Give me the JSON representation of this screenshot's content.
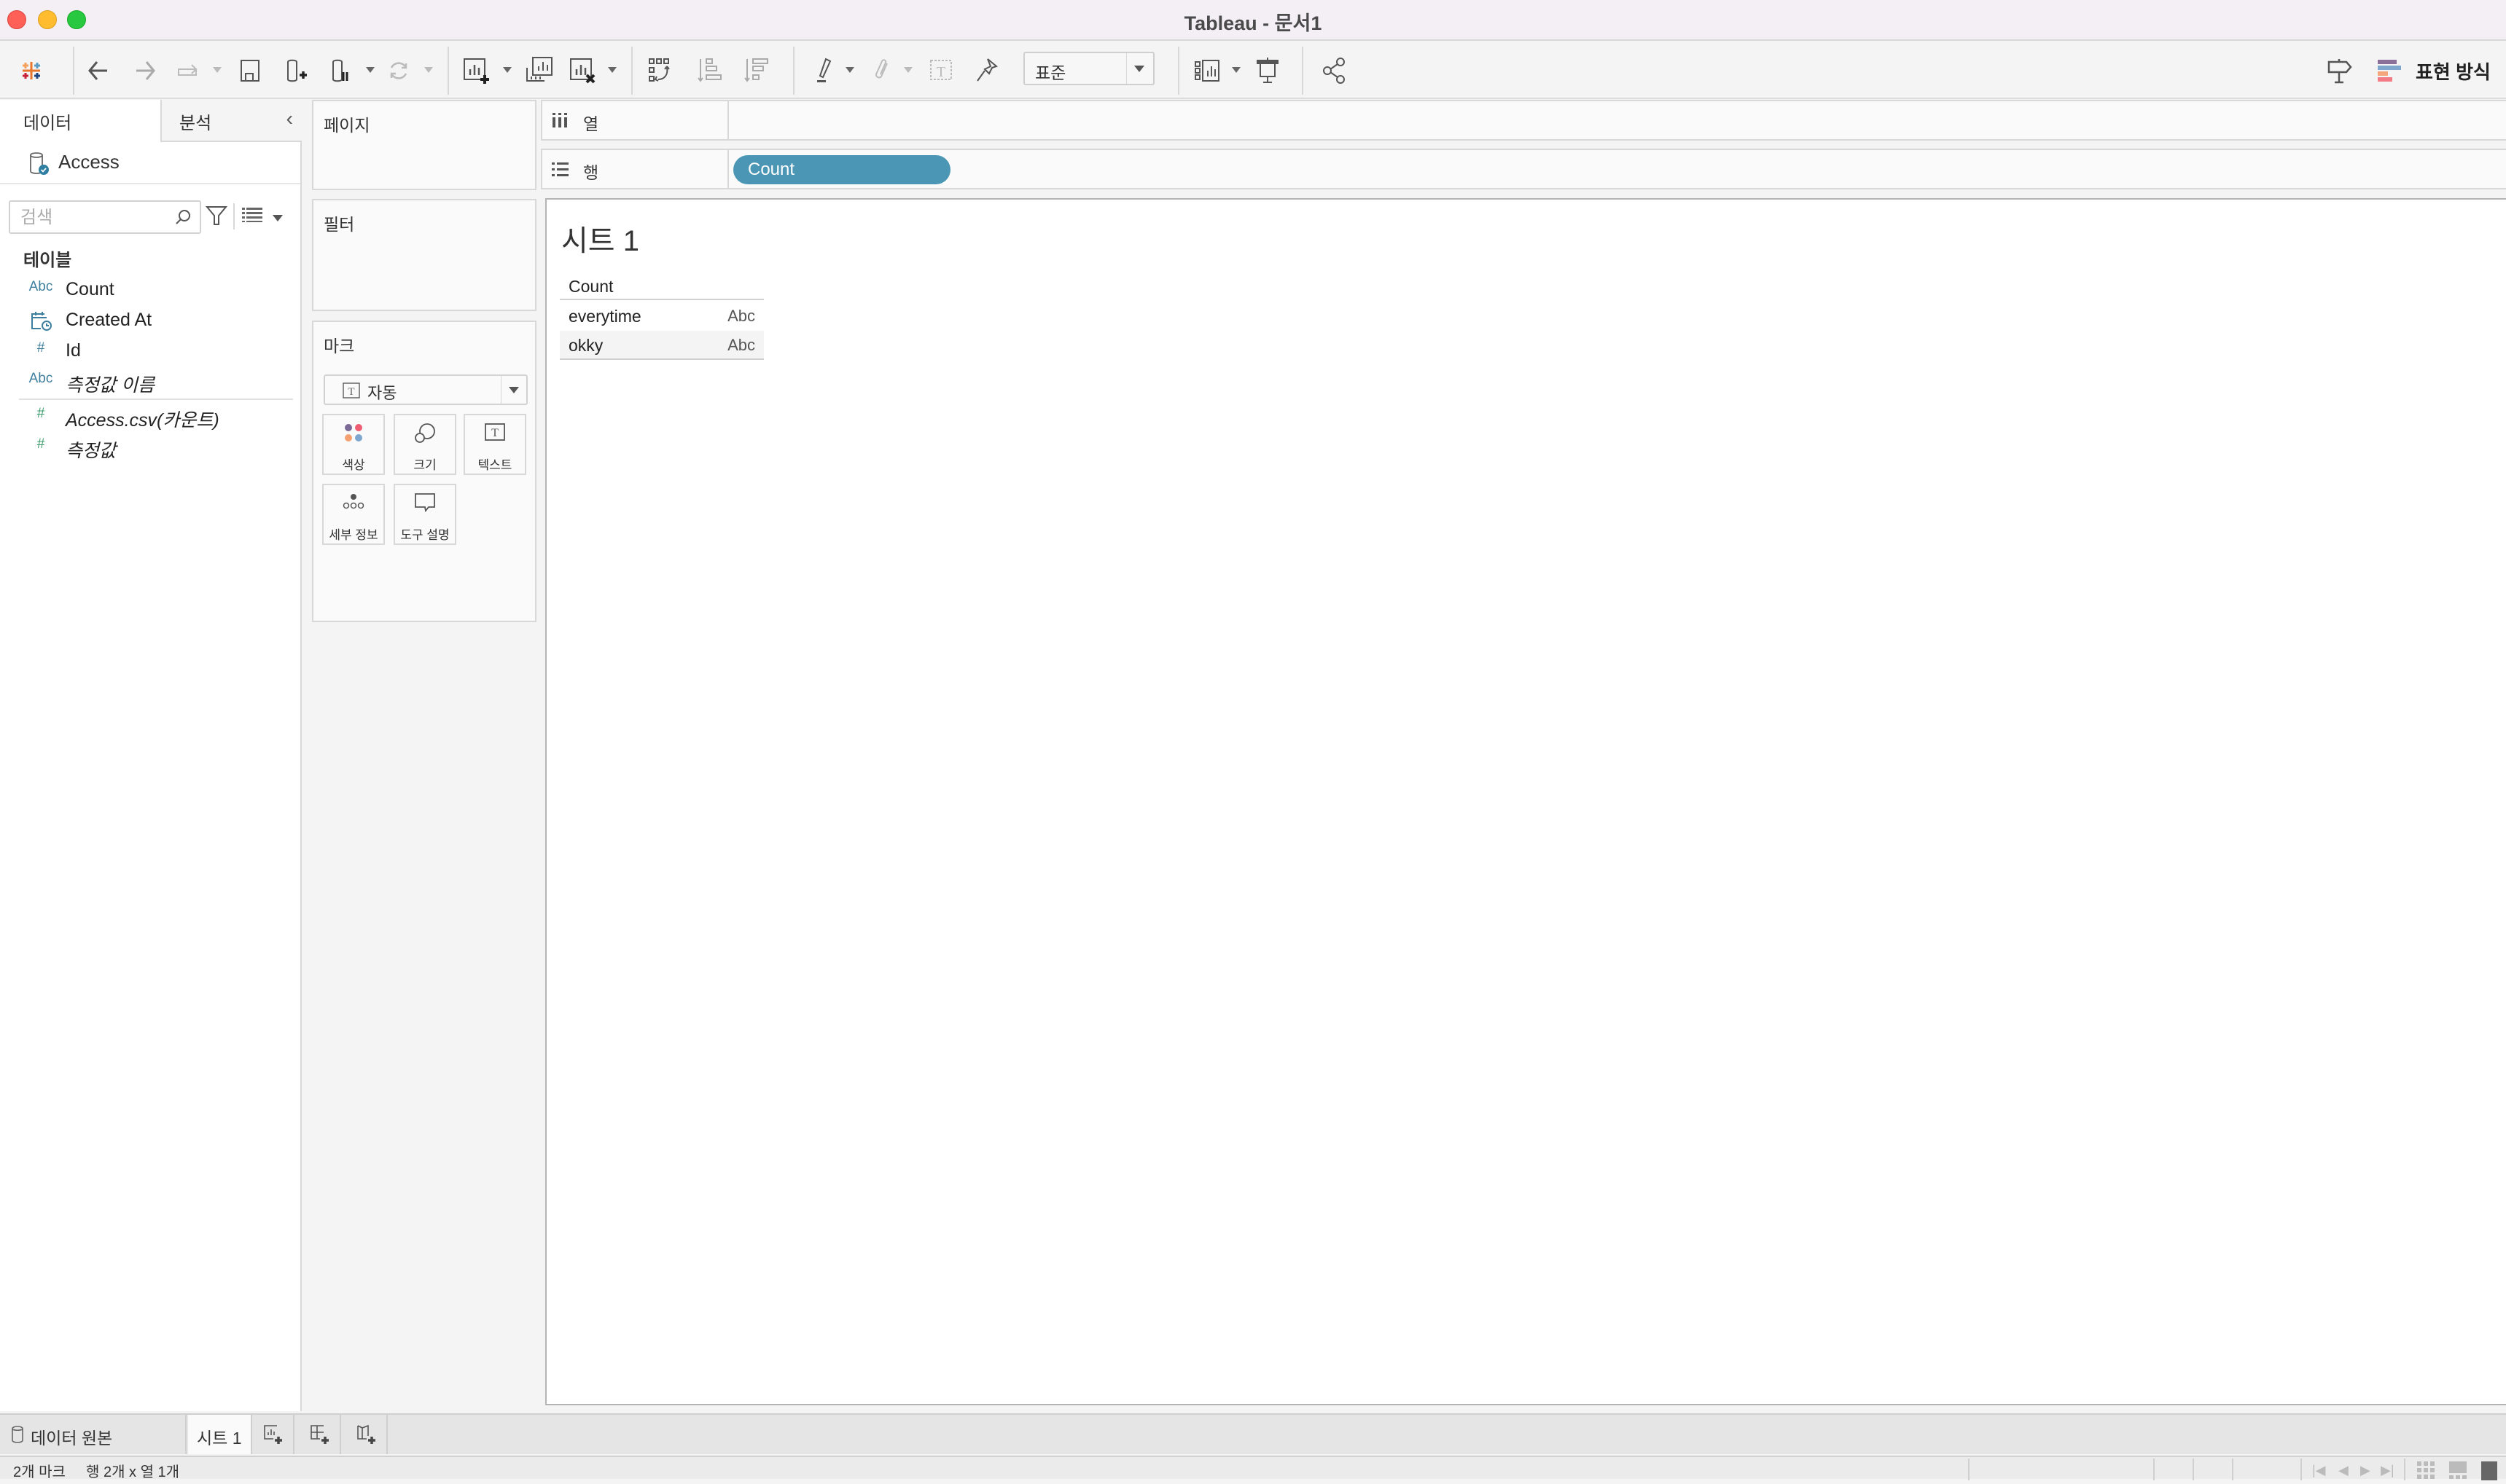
{
  "window": {
    "title": "Tableau - 문서1"
  },
  "toolbar": {
    "fit_select": {
      "value": "표준"
    },
    "show_me_label": "표현 방식",
    "icons": [
      "tableau-logo-icon",
      "undo-icon",
      "redo-icon",
      "replay-icon",
      "save-icon",
      "new-data-source-icon",
      "pause-updates-icon",
      "refresh-icon",
      "new-worksheet-icon",
      "duplicate-sheet-icon",
      "clear-sheet-icon",
      "swap-rows-columns-icon",
      "sort-ascending-icon",
      "sort-descending-icon",
      "highlight-icon",
      "group-members-icon",
      "show-labels-icon",
      "pin-axes-icon",
      "show-cards-icon",
      "presentation-mode-icon",
      "share-icon",
      "guide-icon"
    ]
  },
  "sidebar": {
    "tabs": [
      {
        "label": "데이터",
        "active": true
      },
      {
        "label": "분석",
        "active": false
      }
    ],
    "data_source": "Access",
    "search": {
      "placeholder": "검색",
      "value": ""
    },
    "tables_heading": "테이블",
    "fields": [
      {
        "type": "Abc",
        "type_icon": "string-icon",
        "name": "Count",
        "italic": false
      },
      {
        "type": "date",
        "type_icon": "datetime-icon",
        "name": "Created At",
        "italic": false
      },
      {
        "type": "#",
        "type_icon": "number-icon",
        "name": "Id",
        "italic": false
      },
      {
        "type": "Abc",
        "type_icon": "string-icon",
        "name": "측정값 이름",
        "italic": true
      }
    ],
    "measures": [
      {
        "type": "#",
        "type_icon": "measure-number-icon",
        "name": "Access.csv(카운트)",
        "italic": true
      },
      {
        "type": "#",
        "type_icon": "measure-number-icon",
        "name": "측정값",
        "italic": true
      }
    ]
  },
  "shelves": {
    "pages": "페이지",
    "filters": "필터",
    "marks": {
      "title": "마크",
      "mark_type": "자동",
      "buttons": [
        {
          "label": "색상",
          "icon": "color-icon"
        },
        {
          "label": "크기",
          "icon": "size-icon"
        },
        {
          "label": "텍스트",
          "icon": "text-icon"
        },
        {
          "label": "세부 정보",
          "icon": "detail-icon"
        },
        {
          "label": "도구 설명",
          "icon": "tooltip-icon"
        }
      ]
    },
    "columns": {
      "label": "열",
      "pills": []
    },
    "rows": {
      "label": "행",
      "pills": [
        {
          "label": "Count",
          "color": "#4a96b4"
        }
      ]
    }
  },
  "canvas": {
    "sheet_title": "시트 1",
    "table": {
      "header": "Count",
      "rows": [
        {
          "dimension": "everytime",
          "mark": "Abc"
        },
        {
          "dimension": "okky",
          "mark": "Abc"
        }
      ]
    }
  },
  "tabbar": {
    "data_source_tab": "데이터 원본",
    "sheets": [
      {
        "label": "시트 1",
        "active": true
      }
    ],
    "new_sheet_icons": [
      "new-worksheet-icon",
      "new-dashboard-icon",
      "new-story-icon"
    ]
  },
  "statusbar": {
    "marks": "2개 마크",
    "dimensions": "행 2개 x 열 1개"
  },
  "colors": {
    "accent_pill": "#4a96b4",
    "dimension_icon": "#3e7fa0",
    "measure_icon": "#3a9b6c"
  }
}
